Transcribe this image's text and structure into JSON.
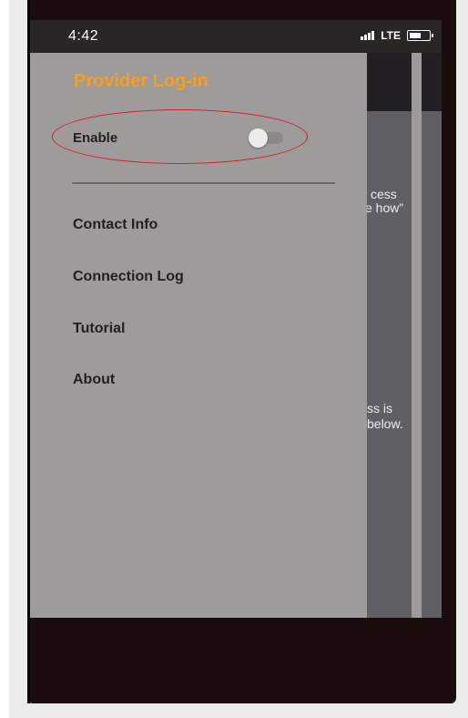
{
  "status_bar": {
    "time": "4:42",
    "network": "LTE",
    "signal_icon": "signal-bars-icon",
    "battery_icon": "battery-icon"
  },
  "drawer": {
    "title": "Provider Log-in",
    "title_color": "#f59f1c",
    "enable_label": "Enable",
    "enable_on": false,
    "menu_items": [
      {
        "label": "Contact Info"
      },
      {
        "label": "Connection Log"
      },
      {
        "label": "Tutorial"
      },
      {
        "label": "About"
      }
    ]
  },
  "background_screen": {
    "text_fragments": [
      "cess",
      "e how”",
      "ss is",
      "below."
    ]
  },
  "annotation": {
    "highlight_color": "#cf1f2b"
  }
}
